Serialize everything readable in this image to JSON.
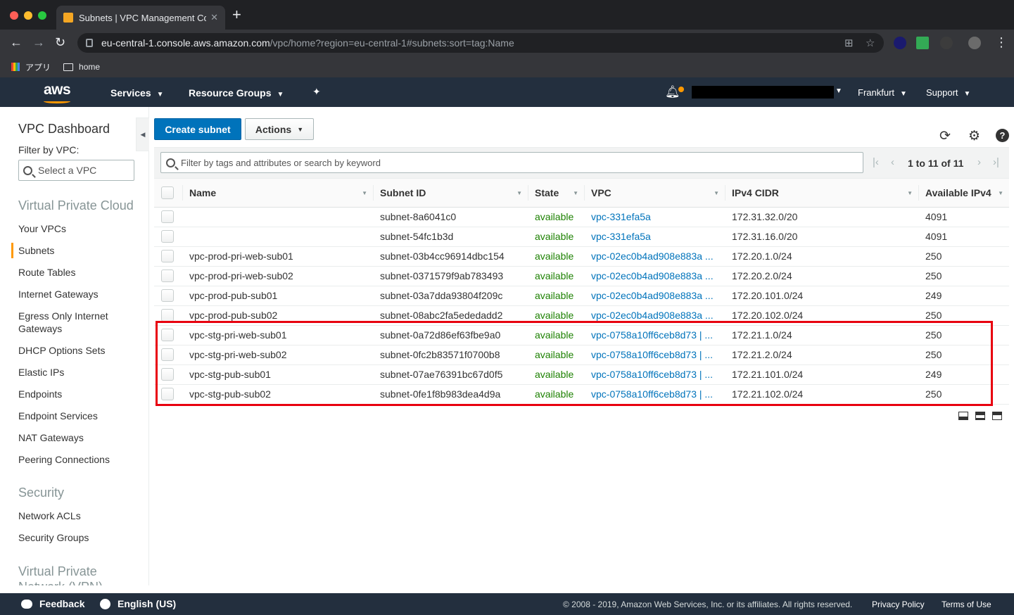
{
  "browser": {
    "tab_title": "Subnets | VPC Management Co",
    "url_host": "eu-central-1.console.aws.amazon.com",
    "url_path": "/vpc/home?region=eu-central-1#subnets:sort=tag:Name",
    "bookmarks": [
      "アプリ",
      "home"
    ]
  },
  "aws_nav": {
    "logo": "aws",
    "services": "Services",
    "resource_groups": "Resource Groups",
    "region": "Frankfurt",
    "support": "Support"
  },
  "sidebar": {
    "title": "VPC Dashboard",
    "filter_label": "Filter by VPC:",
    "vpc_select_placeholder": "Select a VPC",
    "sections": [
      {
        "title": "Virtual Private Cloud",
        "items": [
          "Your VPCs",
          "Subnets",
          "Route Tables",
          "Internet Gateways",
          "Egress Only Internet Gateways",
          "DHCP Options Sets",
          "Elastic IPs",
          "Endpoints",
          "Endpoint Services",
          "NAT Gateways",
          "Peering Connections"
        ]
      },
      {
        "title": "Security",
        "items": [
          "Network ACLs",
          "Security Groups"
        ]
      },
      {
        "title": "Virtual Private Network (VPN)",
        "items": []
      }
    ],
    "active_item": "Subnets"
  },
  "toolbar": {
    "create_label": "Create subnet",
    "actions_label": "Actions"
  },
  "filter": {
    "placeholder": "Filter by tags and attributes or search by keyword",
    "pager_text": "1 to 11 of 11"
  },
  "table": {
    "columns": [
      "Name",
      "Subnet ID",
      "State",
      "VPC",
      "IPv4 CIDR",
      "Available IPv4"
    ],
    "rows": [
      {
        "name": "",
        "subnet_id": "subnet-8a6041c0",
        "state": "available",
        "vpc": "vpc-331efa5a",
        "cidr": "172.31.32.0/20",
        "avail": "4091"
      },
      {
        "name": "",
        "subnet_id": "subnet-54fc1b3d",
        "state": "available",
        "vpc": "vpc-331efa5a",
        "cidr": "172.31.16.0/20",
        "avail": "4091"
      },
      {
        "name": "vpc-prod-pri-web-sub01",
        "subnet_id": "subnet-03b4cc96914dbc154",
        "state": "available",
        "vpc": "vpc-02ec0b4ad908e883a ...",
        "cidr": "172.20.1.0/24",
        "avail": "250"
      },
      {
        "name": "vpc-prod-pri-web-sub02",
        "subnet_id": "subnet-0371579f9ab783493",
        "state": "available",
        "vpc": "vpc-02ec0b4ad908e883a ...",
        "cidr": "172.20.2.0/24",
        "avail": "250"
      },
      {
        "name": "vpc-prod-pub-sub01",
        "subnet_id": "subnet-03a7dda93804f209c",
        "state": "available",
        "vpc": "vpc-02ec0b4ad908e883a ...",
        "cidr": "172.20.101.0/24",
        "avail": "249"
      },
      {
        "name": "vpc-prod-pub-sub02",
        "subnet_id": "subnet-08abc2fa5ededadd2",
        "state": "available",
        "vpc": "vpc-02ec0b4ad908e883a ...",
        "cidr": "172.20.102.0/24",
        "avail": "250"
      },
      {
        "name": "vpc-stg-pri-web-sub01",
        "subnet_id": "subnet-0a72d86ef63fbe9a0",
        "state": "available",
        "vpc": "vpc-0758a10ff6ceb8d73 | ...",
        "cidr": "172.21.1.0/24",
        "avail": "250"
      },
      {
        "name": "vpc-stg-pri-web-sub02",
        "subnet_id": "subnet-0fc2b83571f0700b8",
        "state": "available",
        "vpc": "vpc-0758a10ff6ceb8d73 | ...",
        "cidr": "172.21.2.0/24",
        "avail": "250"
      },
      {
        "name": "vpc-stg-pub-sub01",
        "subnet_id": "subnet-07ae76391bc67d0f5",
        "state": "available",
        "vpc": "vpc-0758a10ff6ceb8d73 | ...",
        "cidr": "172.21.101.0/24",
        "avail": "249"
      },
      {
        "name": "vpc-stg-pub-sub02",
        "subnet_id": "subnet-0fe1f8b983dea4d9a",
        "state": "available",
        "vpc": "vpc-0758a10ff6ceb8d73 | ...",
        "cidr": "172.21.102.0/24",
        "avail": "250"
      }
    ]
  },
  "footer": {
    "feedback": "Feedback",
    "language": "English (US)",
    "copyright": "© 2008 - 2019, Amazon Web Services, Inc. or its affiliates. All rights reserved.",
    "privacy": "Privacy Policy",
    "terms": "Terms of Use"
  },
  "colors": {
    "aws_nav_bg": "#232f3e",
    "primary_button": "#0073bb",
    "state_available": "#1d8102",
    "link": "#0073bb",
    "highlight_box": "#e8000f",
    "accent": "#ff9900"
  },
  "icons": [
    "lock-icon",
    "star-icon",
    "translate-icon",
    "bell-icon",
    "pin-icon",
    "refresh-icon",
    "gear-icon",
    "help-icon",
    "search-icon"
  ]
}
